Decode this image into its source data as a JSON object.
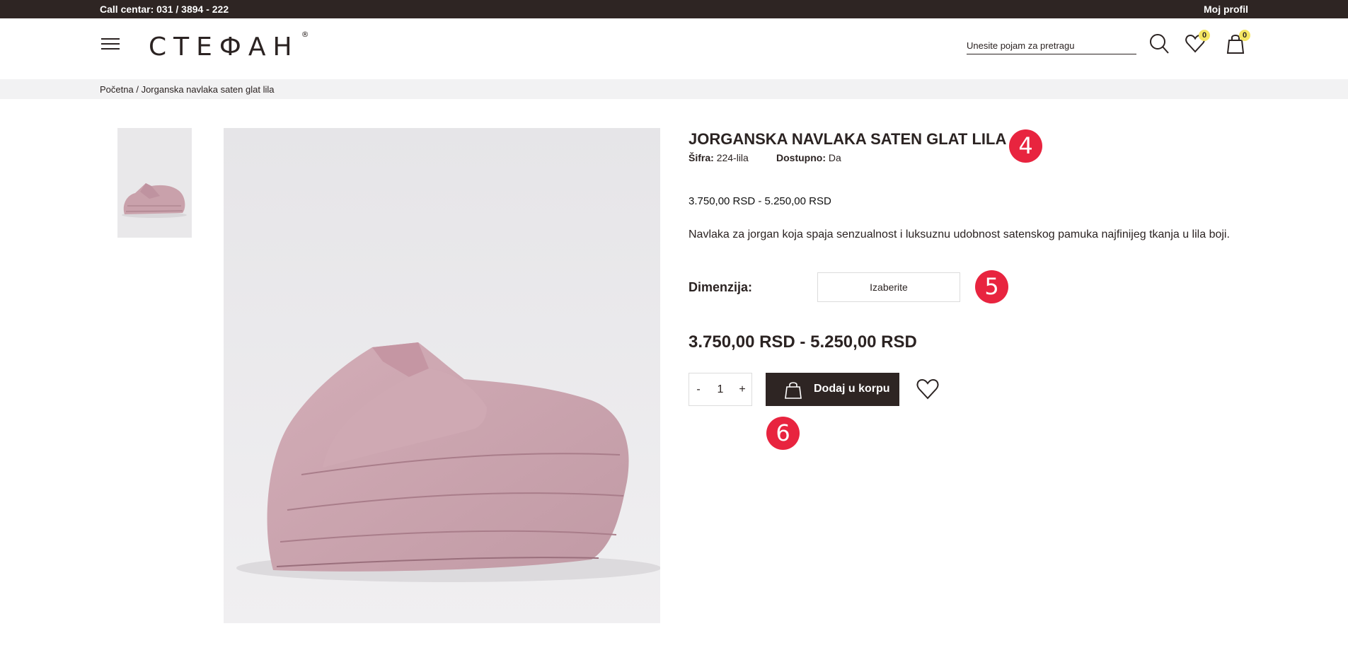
{
  "topbar": {
    "call_center": "Call centar: 031 / 3894 - 222",
    "profile": "Moj profil"
  },
  "header": {
    "logo": "СТЕФАН",
    "logo_mark": "®",
    "search_placeholder": "Unesite pojam za pretragu",
    "wishlist_count": "0",
    "cart_count": "0",
    "icons": [
      "menu-icon",
      "search-icon",
      "heart-icon",
      "bag-icon"
    ],
    "badge_color": "#f5e663"
  },
  "breadcrumb": {
    "home": "Početna",
    "separator": "/",
    "current": "Jorganska navlaka saten glat lila"
  },
  "product": {
    "title": "JORGANSKA NAVLAKA SATEN GLAT LILA",
    "sku_label": "Šifra:",
    "sku_value": "224-lila",
    "availability_label": "Dostupno:",
    "availability_value": "Da",
    "price_range": "3.750,00 RSD - 5.250,00 RSD",
    "description": "Navlaka za jorgan koja spaja senzualnost i luksuznu udobnost satenskog pamuka najfinijeg tkanja u lila boji.",
    "dimension_label": "Dimenzija:",
    "dimension_select": "Izaberite",
    "price_range_large": "3.750,00 RSD - 5.250,00 RSD",
    "quantity": "1",
    "qty_minus": "-",
    "qty_plus": "+",
    "add_to_cart": "Dodaj u korpu",
    "product_color": "#c9a1ab"
  },
  "markers": [
    "4",
    "5",
    "6"
  ],
  "colors": {
    "dark": "#2e2523",
    "marker": "#e8243f",
    "breadcrumb_bg": "#f2f2f3"
  }
}
